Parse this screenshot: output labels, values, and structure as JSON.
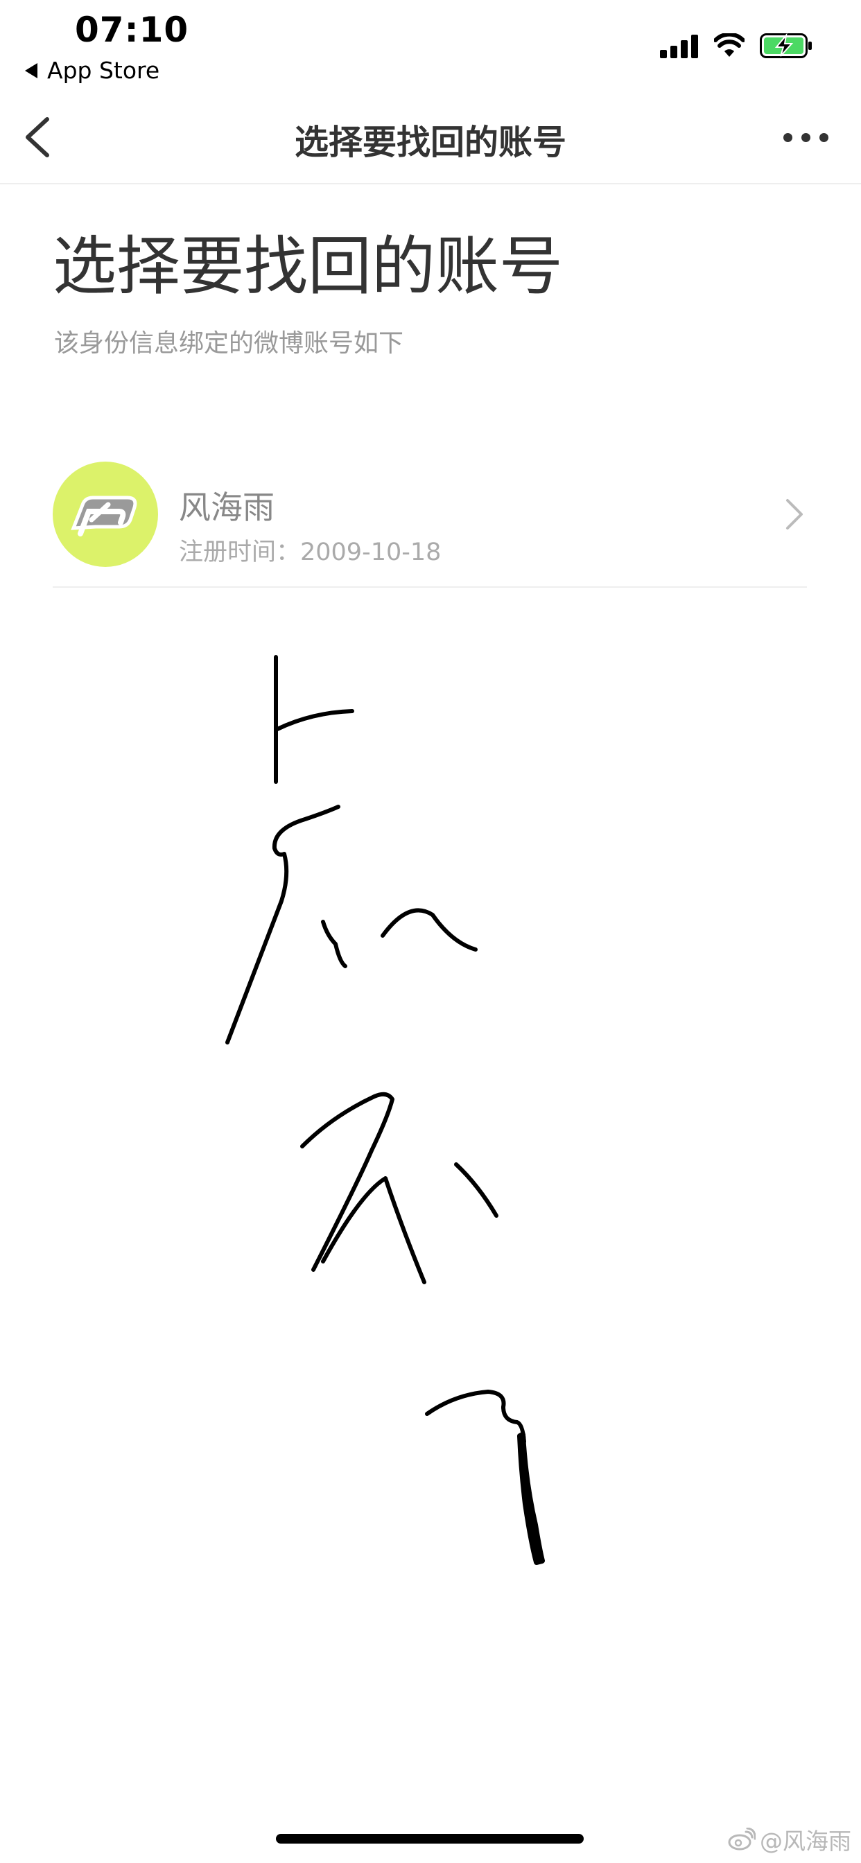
{
  "status_bar": {
    "time": "07:10",
    "back_app": "App Store",
    "icons": [
      "cellular-signal-icon",
      "wifi-icon",
      "battery-charging-icon"
    ],
    "battery_color": "#4cd964"
  },
  "nav": {
    "back_icon": "chevron-left-icon",
    "title": "选择要找回的账号",
    "more_icon": "more-dots-icon"
  },
  "header": {
    "title": "选择要找回的账号",
    "subtitle": "该身份信息绑定的微博账号如下"
  },
  "account": {
    "name": "风海雨",
    "registered": "注册时间：2009-10-18",
    "avatar_color": "#dcf26a",
    "chevron_icon": "chevron-right-icon"
  },
  "watermark": {
    "text": "@风海雨",
    "icon": "weibo-logo-icon"
  }
}
